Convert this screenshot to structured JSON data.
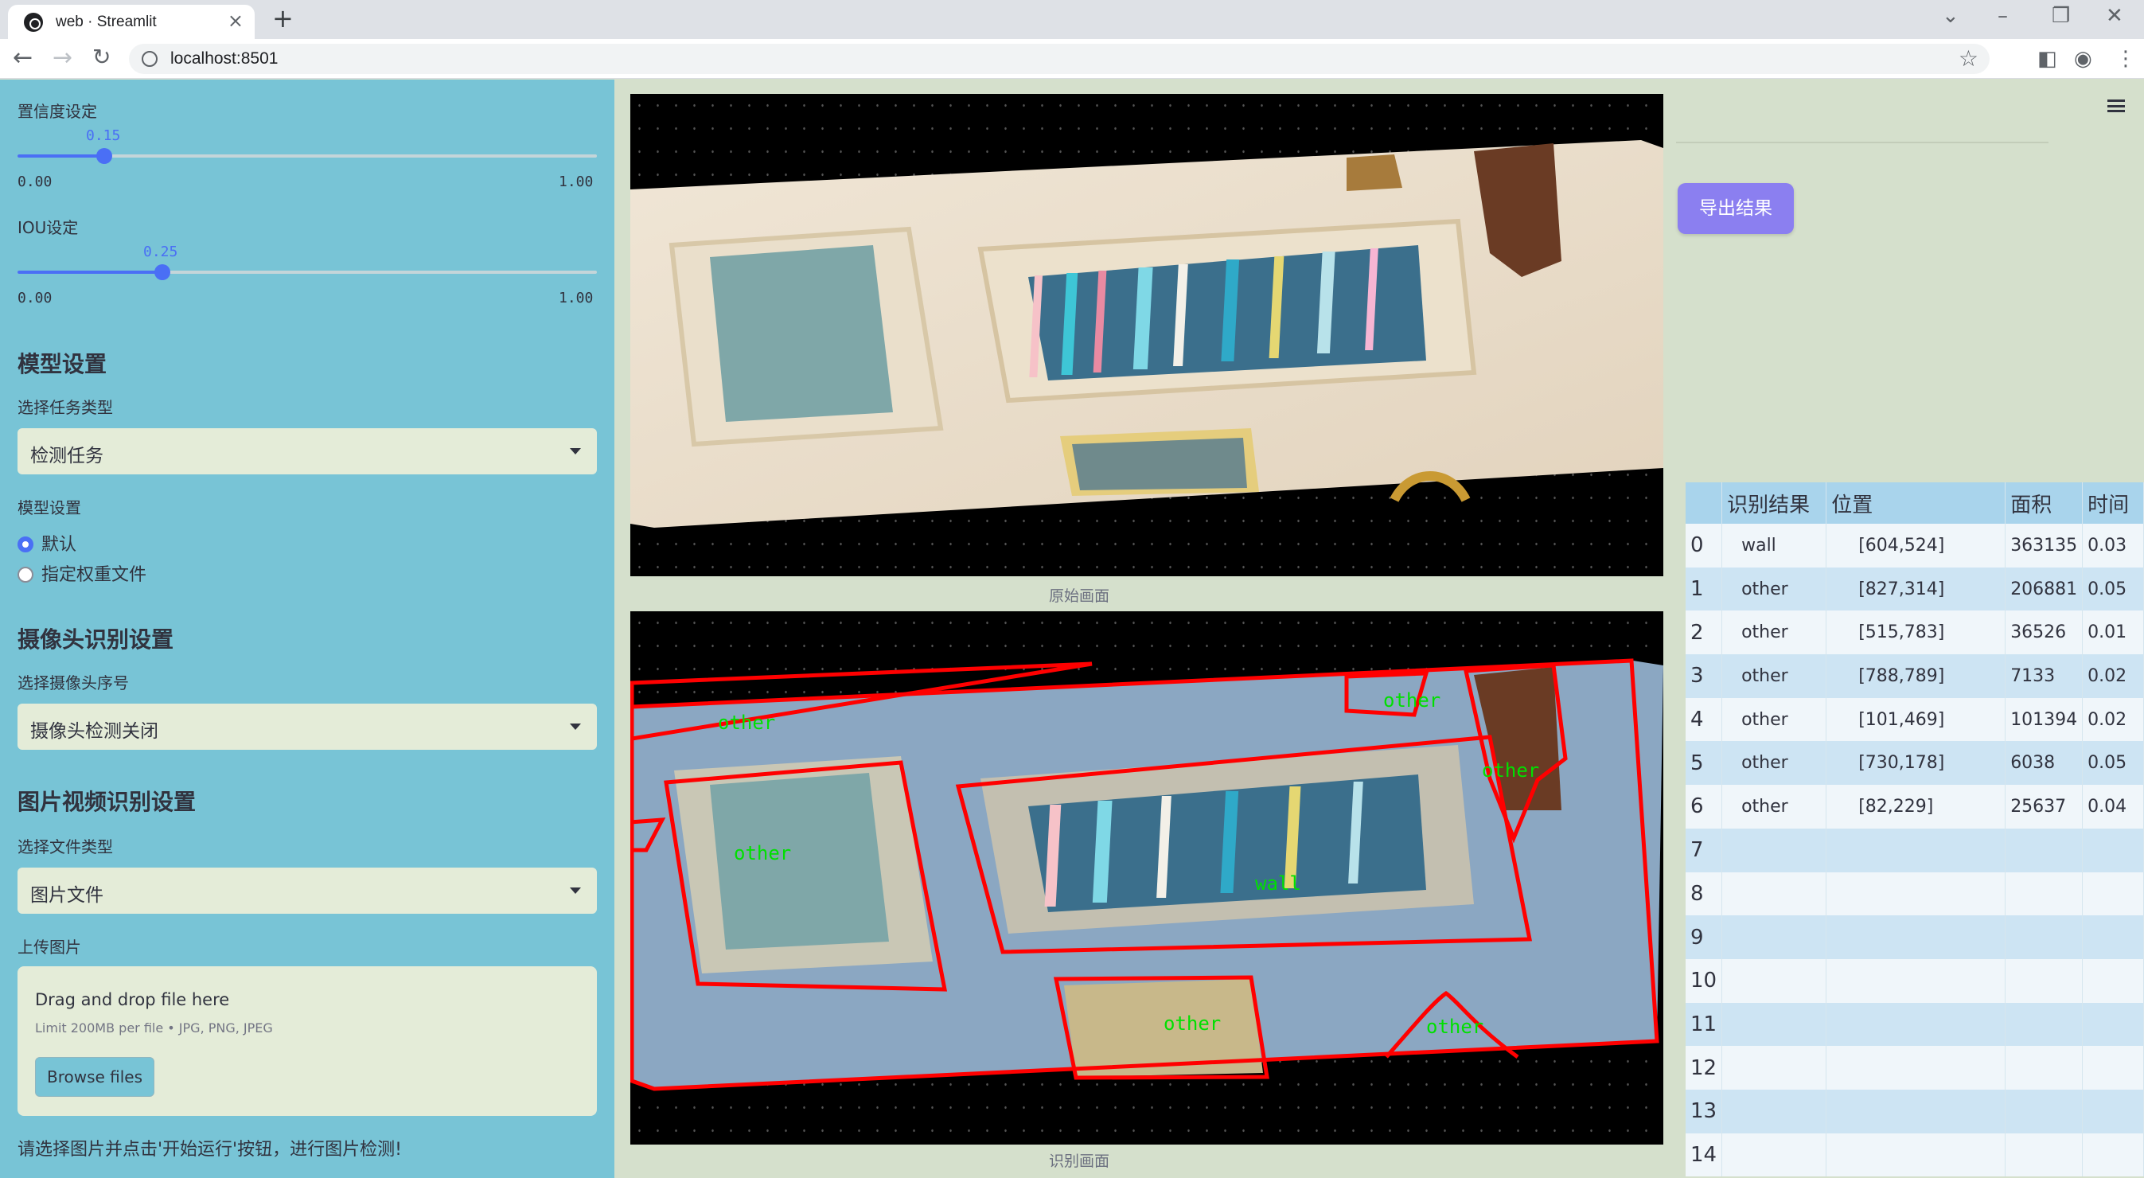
{
  "browser": {
    "tab_title": "web · Streamlit",
    "url": "localhost:8501"
  },
  "sidebar": {
    "conf_label": "置信度设定",
    "conf_value": "0.15",
    "conf_level": 0.15,
    "conf_min": "0.00",
    "conf_max": "1.00",
    "iou_label": "IOU设定",
    "iou_value": "0.25",
    "iou_level": 0.25,
    "iou_min": "0.00",
    "iou_max": "1.00",
    "model_heading": "模型设置",
    "task_label": "选择任务类型",
    "task_value": "检测任务",
    "model_label": "模型设置",
    "radio_default": "默认",
    "radio_custom": "指定权重文件",
    "camera_heading": "摄像头识别设置",
    "camera_label": "选择摄像头序号",
    "camera_value": "摄像头检测关闭",
    "media_heading": "图片视频识别设置",
    "filetype_label": "选择文件类型",
    "filetype_value": "图片文件",
    "upload_label": "上传图片",
    "upload_drag": "Drag and drop file here",
    "upload_limit": "Limit 200MB per file • JPG, PNG, JPEG",
    "upload_button": "Browse files",
    "hint": "请选择图片并点击'开始运行'按钮，进行图片检测!"
  },
  "main": {
    "caption_original": "原始画面",
    "caption_result": "识别画面",
    "detection_labels": [
      "other",
      "other",
      "other",
      "other",
      "wall",
      "other",
      "other"
    ]
  },
  "right": {
    "export_button": "导出结果",
    "table_headers": [
      "",
      "识别结果",
      "位置",
      "面积",
      "时间"
    ],
    "rows": [
      [
        "0",
        "wall",
        "[604,524]",
        "363135",
        "0.03"
      ],
      [
        "1",
        "other",
        "[827,314]",
        "206881",
        "0.05"
      ],
      [
        "2",
        "other",
        "[515,783]",
        "36526",
        "0.01"
      ],
      [
        "3",
        "other",
        "[788,789]",
        "7133",
        "0.02"
      ],
      [
        "4",
        "other",
        "[101,469]",
        "101394",
        "0.02"
      ],
      [
        "5",
        "other",
        "[730,178]",
        "6038",
        "0.05"
      ],
      [
        "6",
        "other",
        "[82,229]",
        "25637",
        "0.04"
      ],
      [
        "7",
        "",
        "",
        "",
        ""
      ],
      [
        "8",
        "",
        "",
        "",
        ""
      ],
      [
        "9",
        "",
        "",
        "",
        ""
      ],
      [
        "10",
        "",
        "",
        "",
        ""
      ],
      [
        "11",
        "",
        "",
        "",
        ""
      ],
      [
        "12",
        "",
        "",
        "",
        ""
      ],
      [
        "13",
        "",
        "",
        "",
        ""
      ],
      [
        "14",
        "",
        "",
        "",
        ""
      ]
    ]
  },
  "colors": {
    "sidebar_bg": "#78c4d6",
    "main_bg": "#d5e0cc",
    "accent": "#4a6ff5",
    "export_button": "#8b7ff0",
    "detection_box": "#ff0000",
    "detection_label": "#00e000"
  }
}
